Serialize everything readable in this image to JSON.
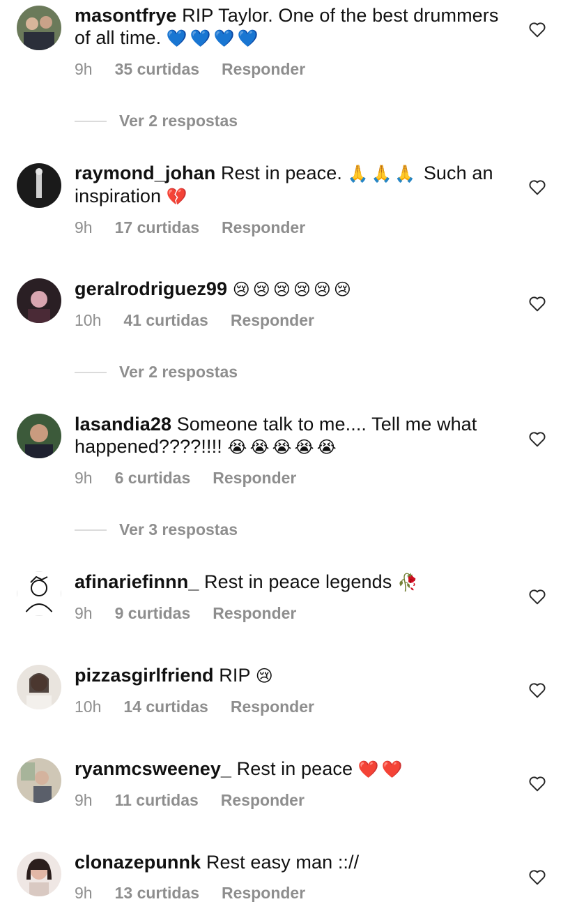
{
  "colors": {
    "meta_text": "#8e8e8e",
    "heart_stroke": "#262626",
    "divider": "#dbdbdb"
  },
  "comments": [
    {
      "username": "masontfrye",
      "text_before": "RIP Taylor. One of the best drummers of all time.",
      "emoji": "💙💙💙💙",
      "text_after": "",
      "time": "9h",
      "likes": "35 curtidas",
      "reply": "Responder",
      "replies_link": "Ver 2 respostas",
      "avatar": "avatar-photo"
    },
    {
      "username": "raymond_johan",
      "text_before": "Rest in peace.",
      "emoji": "🙏🙏🙏",
      "text_after": "Such an inspiration",
      "emoji2": "💔",
      "time": "9h",
      "likes": "17 curtidas",
      "reply": "Responder",
      "avatar": "avatar-photo"
    },
    {
      "username": "geralrodriguez99",
      "text_before": "",
      "emoji": "😢😢😢😢😢😢",
      "text_after": "",
      "time": "10h",
      "likes": "41 curtidas",
      "reply": "Responder",
      "replies_link": "Ver 2 respostas",
      "avatar": "avatar-photo"
    },
    {
      "username": "lasandia28",
      "text_before": "Someone talk to me.... Tell me what happened????!!!!",
      "emoji": "😭😭😭😭😭",
      "text_after": "",
      "time": "9h",
      "likes": "6 curtidas",
      "reply": "Responder",
      "replies_link": "Ver 3 respostas",
      "avatar": "avatar-photo"
    },
    {
      "username": "afinariefinnn_",
      "text_before": "Rest in peace legends",
      "emoji": "🥀",
      "text_after": "",
      "time": "9h",
      "likes": "9 curtidas",
      "reply": "Responder",
      "avatar": "avatar-drawing"
    },
    {
      "username": "pizzasgirlfriend",
      "text_before": "RIP",
      "emoji": "😢",
      "text_after": "",
      "time": "10h",
      "likes": "14 curtidas",
      "reply": "Responder",
      "avatar": "avatar-photo"
    },
    {
      "username": "ryanmcsweeney_",
      "text_before": "Rest in peace",
      "emoji": "❤️❤️",
      "text_after": "",
      "time": "9h",
      "likes": "11 curtidas",
      "reply": "Responder",
      "avatar": "avatar-photo"
    },
    {
      "username": "clonazepunnk",
      "text_before": "Rest easy man :://",
      "emoji": "",
      "text_after": "",
      "time": "9h",
      "likes": "13 curtidas",
      "reply": "Responder",
      "avatar": "avatar-photo"
    }
  ]
}
